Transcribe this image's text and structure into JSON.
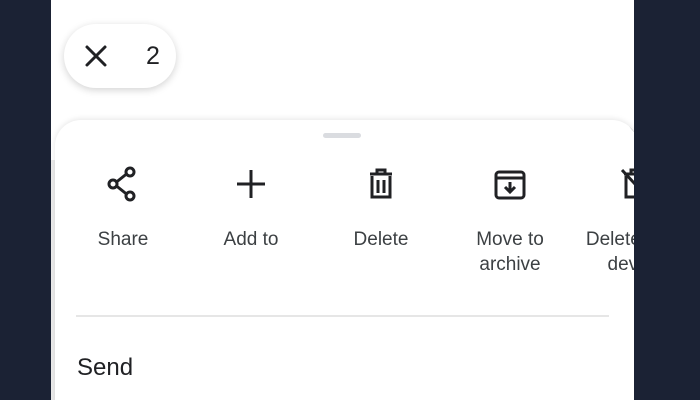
{
  "selection": {
    "count": "2",
    "close_icon": "close-icon"
  },
  "sheet": {
    "actions": [
      {
        "label": "Share",
        "icon": "share-icon"
      },
      {
        "label": "Add to",
        "icon": "plus-icon"
      },
      {
        "label": "Delete",
        "icon": "trash-icon"
      },
      {
        "label": "Move to\narchive",
        "icon": "archive-icon"
      },
      {
        "label": "Delete from\ndevice",
        "icon": "delete-device-icon"
      }
    ],
    "section_title": "Send"
  },
  "colors": {
    "background": "#1b2234",
    "sheet": "#ffffff",
    "text": "#202124"
  }
}
